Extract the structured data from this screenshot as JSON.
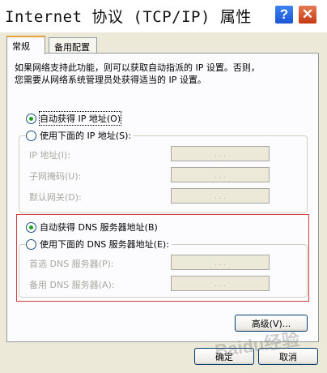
{
  "window": {
    "title": "Internet 协议 (TCP/IP) 属性",
    "help_glyph": "?",
    "close_glyph": "✕"
  },
  "tabs": [
    {
      "label": "常规",
      "active": true
    },
    {
      "label": "备用配置",
      "active": false
    }
  ],
  "description": {
    "line1": "如果网络支持此功能，则可以获取自动指派的 IP 设置。否则，",
    "line2": "您需要从网络系统管理员处获得适当的 IP 设置。"
  },
  "ip_section": {
    "auto_option": {
      "label": "自动获得 IP 地址(O)",
      "checked": true
    },
    "manual_option": {
      "label": "使用下面的 IP 地址(S):",
      "checked": false
    },
    "fields": [
      {
        "label": "IP 地址(I):",
        "value": ". . ."
      },
      {
        "label": "子网掩码(U):",
        "value": ". . ."
      },
      {
        "label": "默认网关(D):",
        "value": ". . ."
      }
    ]
  },
  "dns_section": {
    "auto_option": {
      "label": "自动获得 DNS 服务器地址(B)",
      "checked": true
    },
    "manual_option": {
      "label": "使用下面的 DNS 服务器地址(E):",
      "checked": false
    },
    "fields": [
      {
        "label": "首选 DNS 服务器(P):",
        "value": ". . ."
      },
      {
        "label": "备用 DNS 服务器(A):",
        "value": ". . ."
      }
    ]
  },
  "buttons": {
    "advanced": "高级(V)...",
    "ok": "确定",
    "cancel": "取消"
  },
  "watermark": "Baidu经验",
  "colors": {
    "highlight_border": "#d23c3c",
    "dialog_bg": "#ece9d8",
    "radio_dot": "#21a121"
  }
}
